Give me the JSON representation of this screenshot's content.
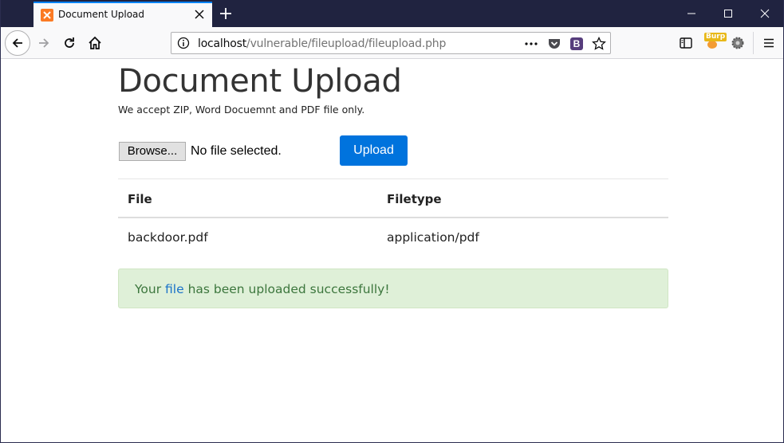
{
  "browser": {
    "tab_title": "Document Upload",
    "url_host": "localhost",
    "url_path": "/vulnerable/fileupload/fileupload.php",
    "burp_label": "Burp",
    "bootstrap_label": "B",
    "accent_color": "#0a84ff",
    "tabstrip_color": "#202340"
  },
  "page": {
    "title": "Document Upload",
    "subtitle": "We accept ZIP, Word Docuemnt and PDF file only.",
    "browse_label": "Browse...",
    "file_status": "No file selected.",
    "upload_label": "Upload",
    "upload_color": "#0073dd"
  },
  "table": {
    "headers": [
      "File",
      "Filetype"
    ],
    "rows": [
      [
        "backdoor.pdf",
        "application/pdf"
      ]
    ]
  },
  "alert": {
    "prefix": "Your ",
    "link_text": "file",
    "suffix": " has been uploaded successfully!",
    "bg_color": "#dff0d8",
    "text_color": "#3c763d"
  }
}
